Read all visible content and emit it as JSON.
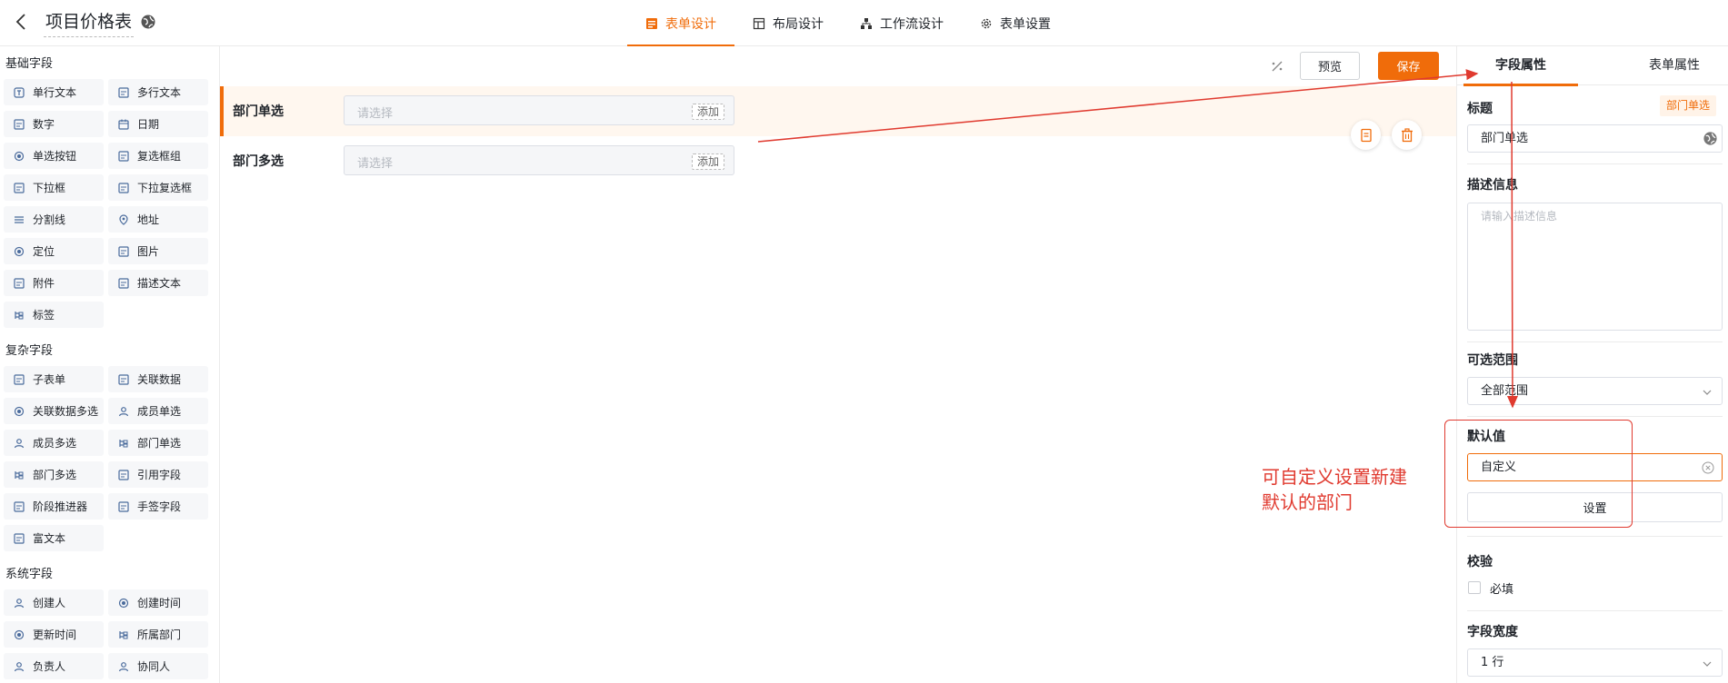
{
  "header": {
    "app_title": "项目价格表",
    "tabs": [
      {
        "label": "表单设计",
        "icon": "form-icon",
        "active": true
      },
      {
        "label": "布局设计",
        "icon": "layout-icon",
        "active": false
      },
      {
        "label": "工作流设计",
        "icon": "workflow-icon",
        "active": false
      },
      {
        "label": "表单设置",
        "icon": "gear-icon",
        "active": false
      }
    ]
  },
  "sidebar": {
    "basic_title": "基础字段",
    "basic": [
      "单行文本",
      "多行文本",
      "数字",
      "日期",
      "单选按钮",
      "复选框组",
      "下拉框",
      "下拉复选框",
      "分割线",
      "地址",
      "定位",
      "图片",
      "附件",
      "描述文本",
      "标签"
    ],
    "complex_title": "复杂字段",
    "complex": [
      "子表单",
      "关联数据",
      "关联数据多选",
      "成员单选",
      "成员多选",
      "部门单选",
      "部门多选",
      "引用字段",
      "阶段推进器",
      "手签字段",
      "富文本"
    ],
    "system_title": "系统字段",
    "system": [
      "创建人",
      "创建时间",
      "更新时间",
      "所属部门",
      "负责人",
      "协同人"
    ]
  },
  "canvas": {
    "preview_label": "预览",
    "save_label": "保存",
    "fields": [
      {
        "label": "部门单选",
        "placeholder": "请选择",
        "add_label": "添加"
      },
      {
        "label": "部门多选",
        "placeholder": "请选择",
        "add_label": "添加"
      }
    ]
  },
  "props": {
    "tab_field": "字段属性",
    "tab_form": "表单属性",
    "title_label": "标题",
    "field_type_tag": "部门单选",
    "title_value": "部门单选",
    "desc_label": "描述信息",
    "desc_placeholder": "请输入描述信息",
    "range_label": "可选范围",
    "range_value": "全部范围",
    "default_label": "默认值",
    "default_value": "自定义",
    "set_button": "设置",
    "validate_label": "校验",
    "required_label": "必填",
    "width_label": "字段宽度",
    "width_value": "1 行"
  },
  "annotation": {
    "text_line1": "可自定义设置新建",
    "text_line2": "默认的部门"
  },
  "colors": {
    "accent": "#f06c0a",
    "annotation": "#e03a2f"
  }
}
